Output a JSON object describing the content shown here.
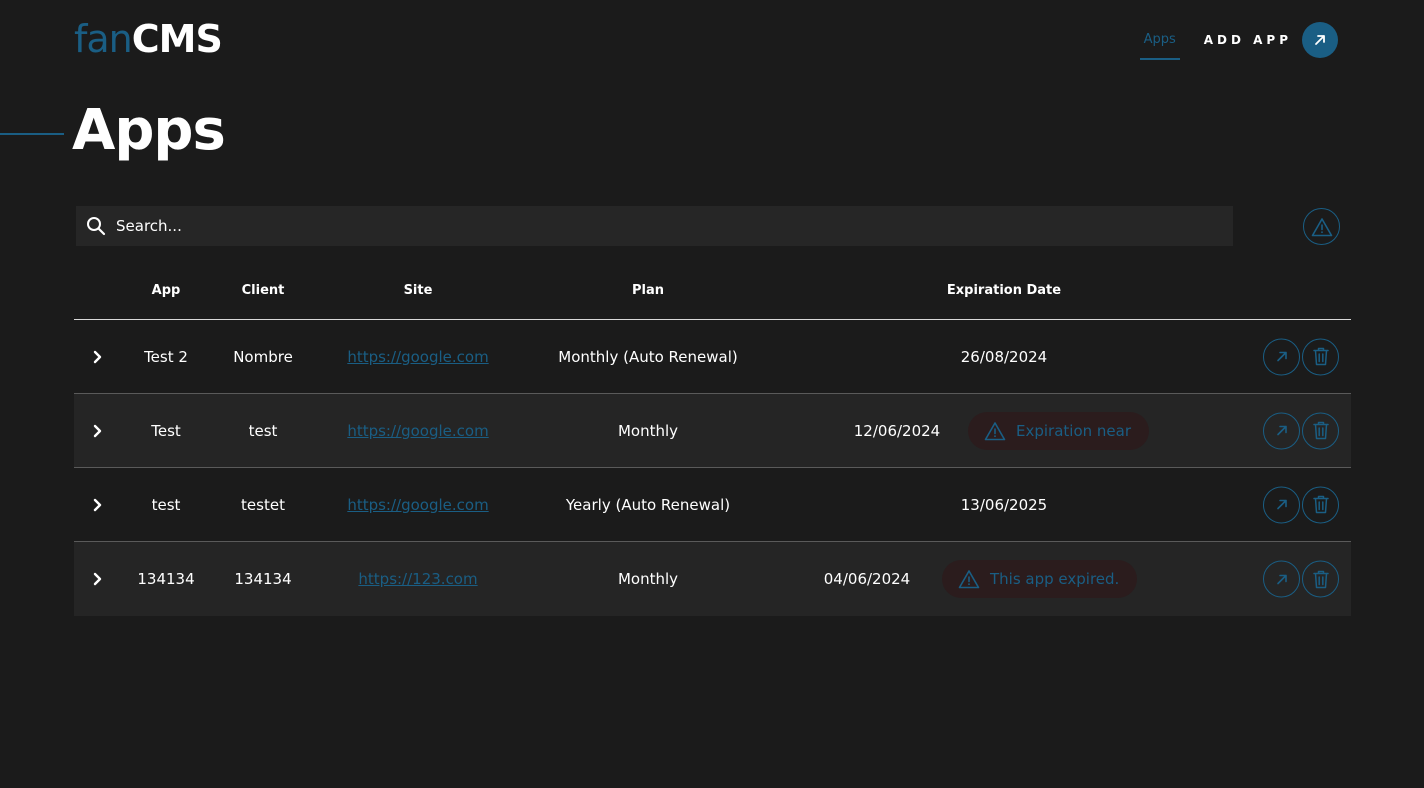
{
  "header": {
    "logo_part1": "fan",
    "logo_part2": "CMS",
    "nav_apps": "Apps",
    "nav_add_app": "ADD APP"
  },
  "page": {
    "title": "Apps"
  },
  "search": {
    "placeholder": "Search..."
  },
  "table": {
    "headers": {
      "app": "App",
      "client": "Client",
      "site": "Site",
      "plan": "Plan",
      "expiration": "Expiration Date"
    },
    "rows": [
      {
        "app": "Test 2",
        "client": "Nombre",
        "site": "https://google.com",
        "plan": "Monthly (Auto Renewal)",
        "expiration": "26/08/2024",
        "badge": ""
      },
      {
        "app": "Test",
        "client": "test",
        "site": "https://google.com",
        "plan": "Monthly",
        "expiration": "12/06/2024",
        "badge": "Expiration near"
      },
      {
        "app": "test",
        "client": "testet",
        "site": "https://google.com",
        "plan": "Yearly (Auto Renewal)",
        "expiration": "13/06/2025",
        "badge": ""
      },
      {
        "app": "134134",
        "client": "134134",
        "site": "https://123.com",
        "plan": "Monthly",
        "expiration": "04/06/2024",
        "badge": "This app expired."
      }
    ]
  },
  "icons": {
    "search": "search-icon",
    "warning_filter": "warning-icon",
    "expand": "chevron-right-icon",
    "open": "arrow-up-right-icon",
    "delete": "trash-icon"
  },
  "colors": {
    "accent": "#1a5e84",
    "background": "#1b1b1b",
    "row_alt": "#252525",
    "badge_bg": "#2b1c1d"
  }
}
